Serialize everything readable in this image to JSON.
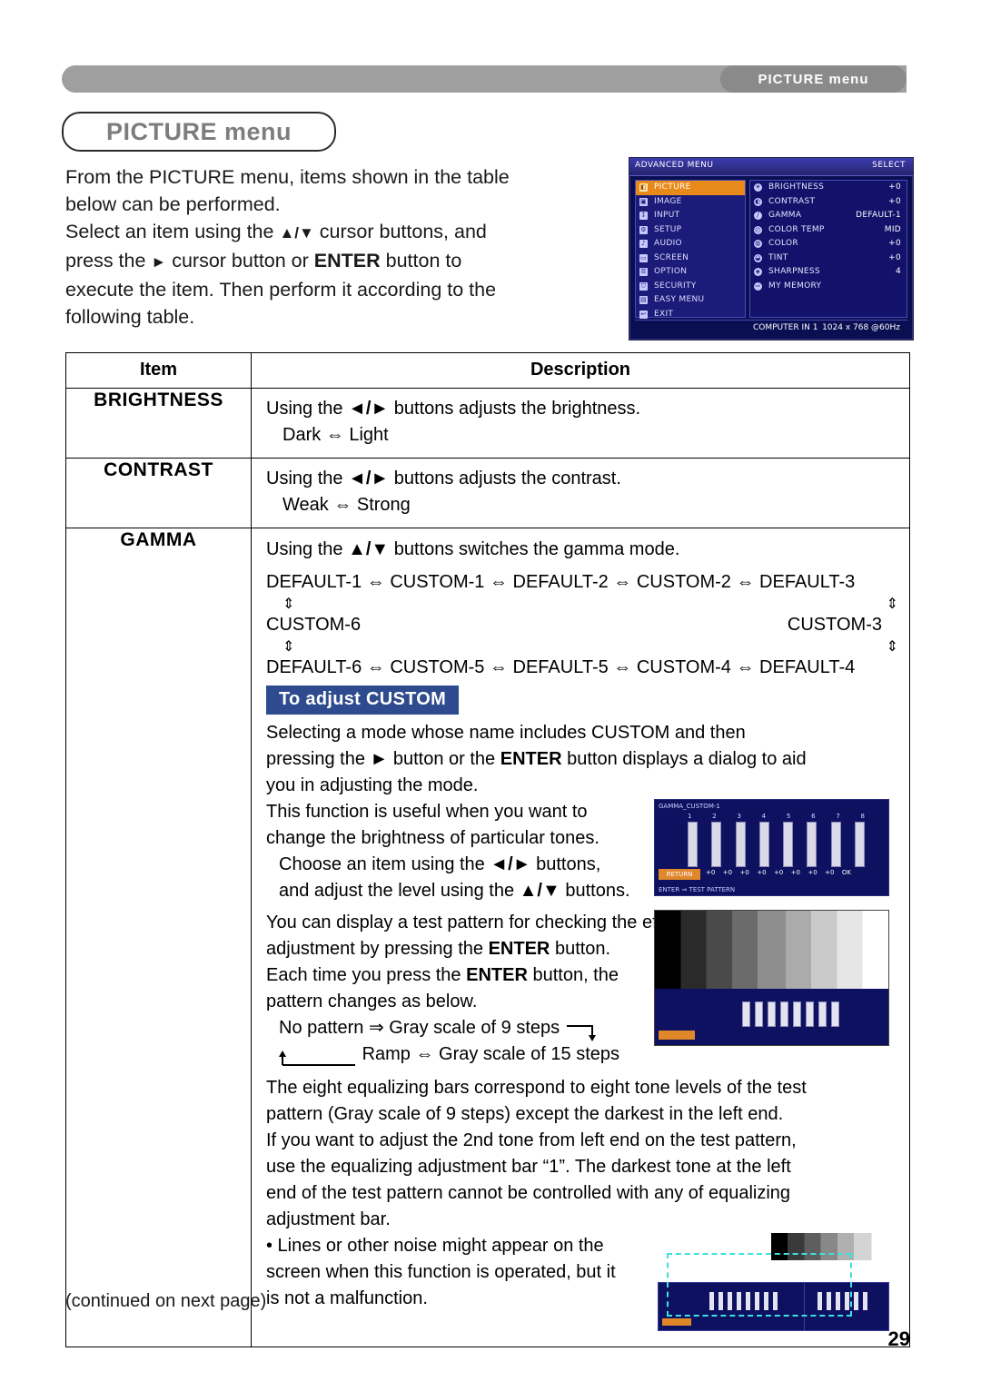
{
  "header": {
    "running_head": "PICTURE menu"
  },
  "title": "PICTURE menu",
  "intro": {
    "l1": "From the PICTURE menu, items shown in the table",
    "l2": "below can be performed.",
    "l3_a": "Select an item using the ",
    "l3_updown": "▲/▼",
    "l3_b": " cursor buttons, and",
    "l4_a": "press the ",
    "l4_right": "►",
    "l4_b": " cursor button or ",
    "l4_enter": "ENTER",
    "l4_c": " button to",
    "l5": "execute the item. Then perform it according to the",
    "l6": "following table."
  },
  "osd_top": {
    "titlebar_left": "ADVANCED MENU",
    "titlebar_right": "SELECT",
    "left_items": [
      {
        "label": "PICTURE",
        "selected": true
      },
      {
        "label": "IMAGE",
        "selected": false
      },
      {
        "label": "INPUT",
        "selected": false
      },
      {
        "label": "SETUP",
        "selected": false
      },
      {
        "label": "AUDIO",
        "selected": false
      },
      {
        "label": "SCREEN",
        "selected": false
      },
      {
        "label": "OPTION",
        "selected": false
      },
      {
        "label": "SECURITY",
        "selected": false
      },
      {
        "label": "EASY MENU",
        "selected": false
      },
      {
        "label": "EXIT",
        "selected": false
      }
    ],
    "right_items": [
      {
        "label": "BRIGHTNESS",
        "value": "+0"
      },
      {
        "label": "CONTRAST",
        "value": "+0"
      },
      {
        "label": "GAMMA",
        "value": "DEFAULT-1"
      },
      {
        "label": "COLOR TEMP",
        "value": "MID"
      },
      {
        "label": "COLOR",
        "value": "+0"
      },
      {
        "label": "TINT",
        "value": "+0"
      },
      {
        "label": "SHARPNESS",
        "value": "4"
      },
      {
        "label": "MY MEMORY",
        "value": ""
      }
    ],
    "footer_source": "COMPUTER IN 1",
    "footer_mode": "1024 x 768 @60Hz"
  },
  "table": {
    "headers": {
      "item": "Item",
      "description": "Description"
    },
    "rows": [
      {
        "item": "BRIGHTNESS",
        "desc_line1_a": "Using the ",
        "desc_line1_icons": "◄/►",
        "desc_line1_b": " buttons adjusts the brightness.",
        "desc_line2": "Dark ⇔ Light"
      },
      {
        "item": "CONTRAST",
        "desc_line1_a": "Using the ",
        "desc_line1_icons": "◄/►",
        "desc_line1_b": " buttons adjusts the contrast.",
        "desc_line2": "Weak ⇔ Strong"
      }
    ],
    "gamma": {
      "item": "GAMMA",
      "intro_a": "Using the ",
      "intro_icons": "▲/▼",
      "intro_b": " buttons switches the gamma mode.",
      "cycle_row1": "DEFAULT-1 ⇔ CUSTOM-1 ⇔ DEFAULT-2 ⇔ CUSTOM-2 ⇔ DEFAULT-3",
      "cycle_row2_left": "CUSTOM-6",
      "cycle_row2_right": "CUSTOM-3",
      "cycle_row3": "DEFAULT-6 ⇔ CUSTOM-5 ⇔ DEFAULT-5 ⇔ CUSTOM-4 ⇔ DEFAULT-4",
      "updown_arrow": "⇕",
      "banner": "To adjust CUSTOM",
      "p1_l1": "Selecting a mode whose name includes CUSTOM and then",
      "p1_l2_a": "pressing the ",
      "p1_l2_right": "►",
      "p1_l2_b": " button or the ",
      "p1_l2_enter": "ENTER",
      "p1_l2_c": " button displays a dialog to aid",
      "p1_l3": "you in adjusting the mode.",
      "p2_l1": "This function is useful when you want to",
      "p2_l2": "change the brightness of particular tones.",
      "p3_l1_a": "Choose an item using the ",
      "p3_l1_icons": "◄/►",
      "p3_l1_b": " buttons,",
      "p3_l2_a": "and  adjust the level using the ",
      "p3_l2_icons": "▲/▼",
      "p3_l2_b": " buttons.",
      "p4_l1": "You can display a test pattern for checking the effect of your",
      "p4_l2_a": "adjustment by pressing the ",
      "p4_l2_enter": "ENTER",
      "p4_l2_b": " button.",
      "p4_l3_a": "Each time you press the ",
      "p4_l3_enter": "ENTER",
      "p4_l3_b": " button, the",
      "p4_l4": "pattern changes as below.",
      "cycle2_l1": "No pattern ⇒ Gray scale of 9 steps",
      "cycle2_l2": "Ramp ⇔ Gray scale of 15 steps",
      "p5_l1": "The eight equalizing bars correspond to eight tone levels of the test",
      "p5_l2": "pattern (Gray scale of 9 steps) except the darkest in the left end.",
      "p5_l3": "If you want to adjust the 2nd tone from left end on the test pattern,",
      "p5_l4": "use the equalizing adjustment bar “1”. The darkest tone at the left",
      "p5_l5": "end of the test pattern cannot be controlled with any of equalizing",
      "p5_l6": "adjustment bar.",
      "p6_l1": "• Lines or other noise might appear on the",
      "p6_l2": "screen when this function is operated, but it",
      "p6_l3": "is not a malfunction.",
      "dialog_img": {
        "title": "GAMMA_CUSTOM-1",
        "numbers": [
          "1",
          "2",
          "3",
          "4",
          "5",
          "6",
          "7",
          "8"
        ],
        "values": [
          "+0",
          "+0",
          "+0",
          "+0",
          "+0",
          "+0",
          "+0",
          "+0"
        ],
        "return_label": "RETURN",
        "ok_label": "OK",
        "footer": "ENTER ⇒ TEST PATTERN"
      }
    }
  },
  "footer": {
    "continued": "(continued on next page)",
    "page_number": "29"
  }
}
